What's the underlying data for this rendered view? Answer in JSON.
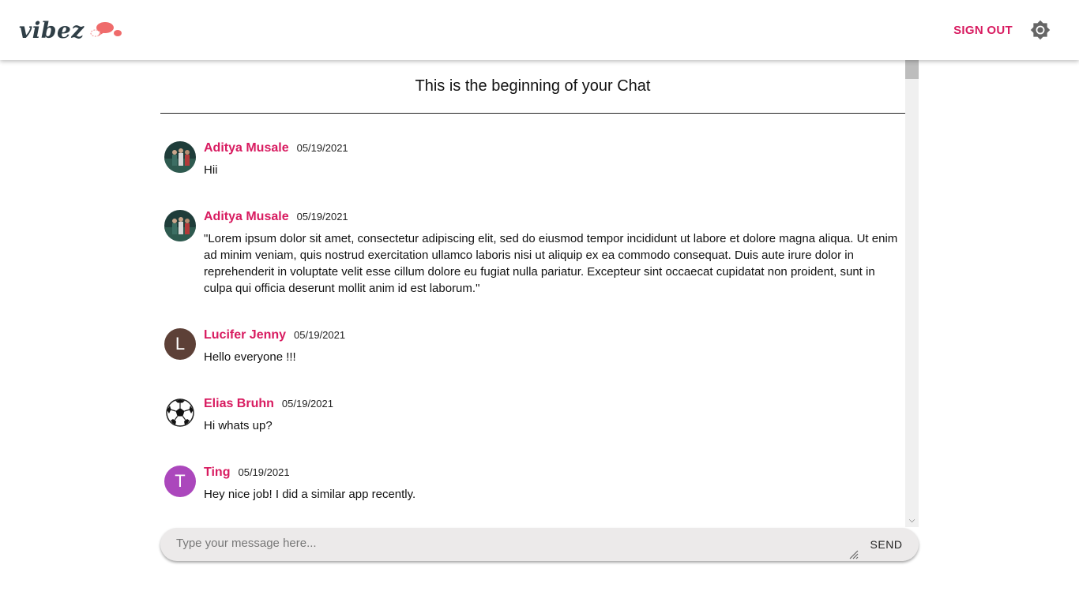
{
  "app": {
    "logo_text": "vibez",
    "sign_out_label": "SIGN OUT",
    "accent_color": "#d81b60"
  },
  "chat": {
    "header_text": "This is the beginning of your Chat",
    "messages": [
      {
        "name": "Aditya Musale",
        "date": "05/19/2021",
        "text": "Hii",
        "avatar": {
          "type": "photo",
          "icon": "group-photo-avatar"
        }
      },
      {
        "name": "Aditya Musale",
        "date": "05/19/2021",
        "text": "\"Lorem ipsum dolor sit amet, consectetur adipiscing elit, sed do eiusmod tempor incididunt ut labore et dolore magna aliqua. Ut enim ad minim veniam, quis nostrud exercitation ullamco laboris nisi ut aliquip ex ea commodo consequat. Duis aute irure dolor in reprehenderit in voluptate velit esse cillum dolore eu fugiat nulla pariatur. Excepteur sint occaecat cupidatat non proident, sunt in culpa qui officia deserunt mollit anim id est laborum.\"",
        "avatar": {
          "type": "photo",
          "icon": "group-photo-avatar"
        }
      },
      {
        "name": "Lucifer Jenny",
        "date": "05/19/2021",
        "text": "Hello everyone !!!",
        "avatar": {
          "type": "letter",
          "letter": "L",
          "color": "#5d4037"
        }
      },
      {
        "name": "Elias Bruhn",
        "date": "05/19/2021",
        "text": "Hi whats up?",
        "avatar": {
          "type": "icon",
          "icon": "soccer-ball-avatar"
        }
      },
      {
        "name": "Ting",
        "date": "05/19/2021",
        "text": "Hey nice job! I did a similar app recently.",
        "avatar": {
          "type": "letter",
          "letter": "T",
          "color": "#ab47bc"
        }
      }
    ]
  },
  "composer": {
    "placeholder": "Type your message here...",
    "value": "",
    "send_label": "SEND"
  },
  "icons": {
    "theme_toggle": "brightness-icon",
    "logo_mark": "chat-bubbles-icon",
    "scroll_down": "chevron-down-icon"
  }
}
